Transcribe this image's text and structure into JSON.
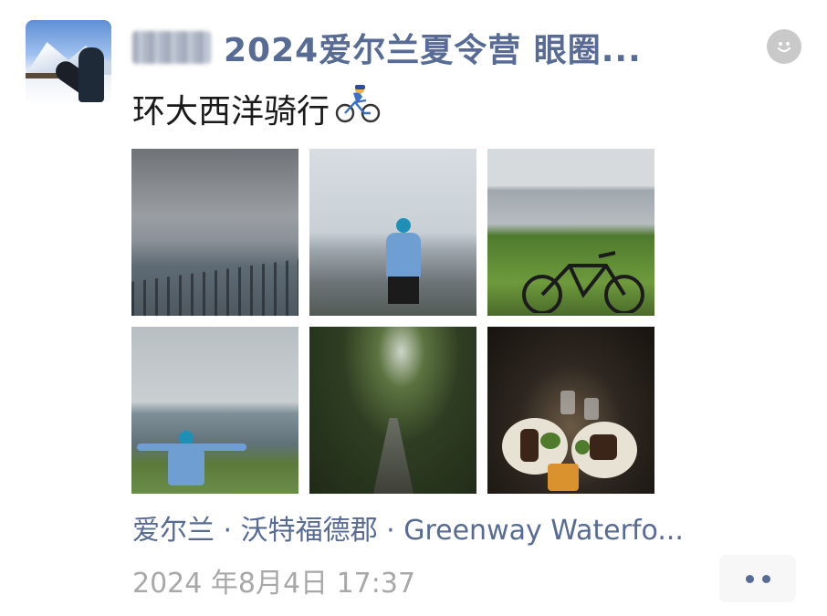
{
  "post": {
    "author_name": "2024爱尔兰夏令营 眼圈...",
    "text": "环大西洋骑行",
    "emoji": "bicyclist-icon",
    "location": "爱尔兰 · 沃特福德郡 · Greenway Waterfo...",
    "timestamp": "2024 年8月4日 17:37",
    "photos": [
      {
        "id": "photo-1",
        "subject": "seaside-railing"
      },
      {
        "id": "photo-2",
        "subject": "cyclist-by-sea"
      },
      {
        "id": "photo-3",
        "subject": "bicycle-on-grass"
      },
      {
        "id": "photo-4",
        "subject": "cyclist-arms-open"
      },
      {
        "id": "photo-5",
        "subject": "forest-greenway-path"
      },
      {
        "id": "photo-6",
        "subject": "dinner-steak-plates"
      }
    ]
  },
  "icons": {
    "avatar": "avatar",
    "like": "smile-icon",
    "more": "more-dots-icon"
  },
  "colors": {
    "link": "#576b95",
    "meta": "#a8a8a8",
    "text": "#1a1a1a"
  }
}
